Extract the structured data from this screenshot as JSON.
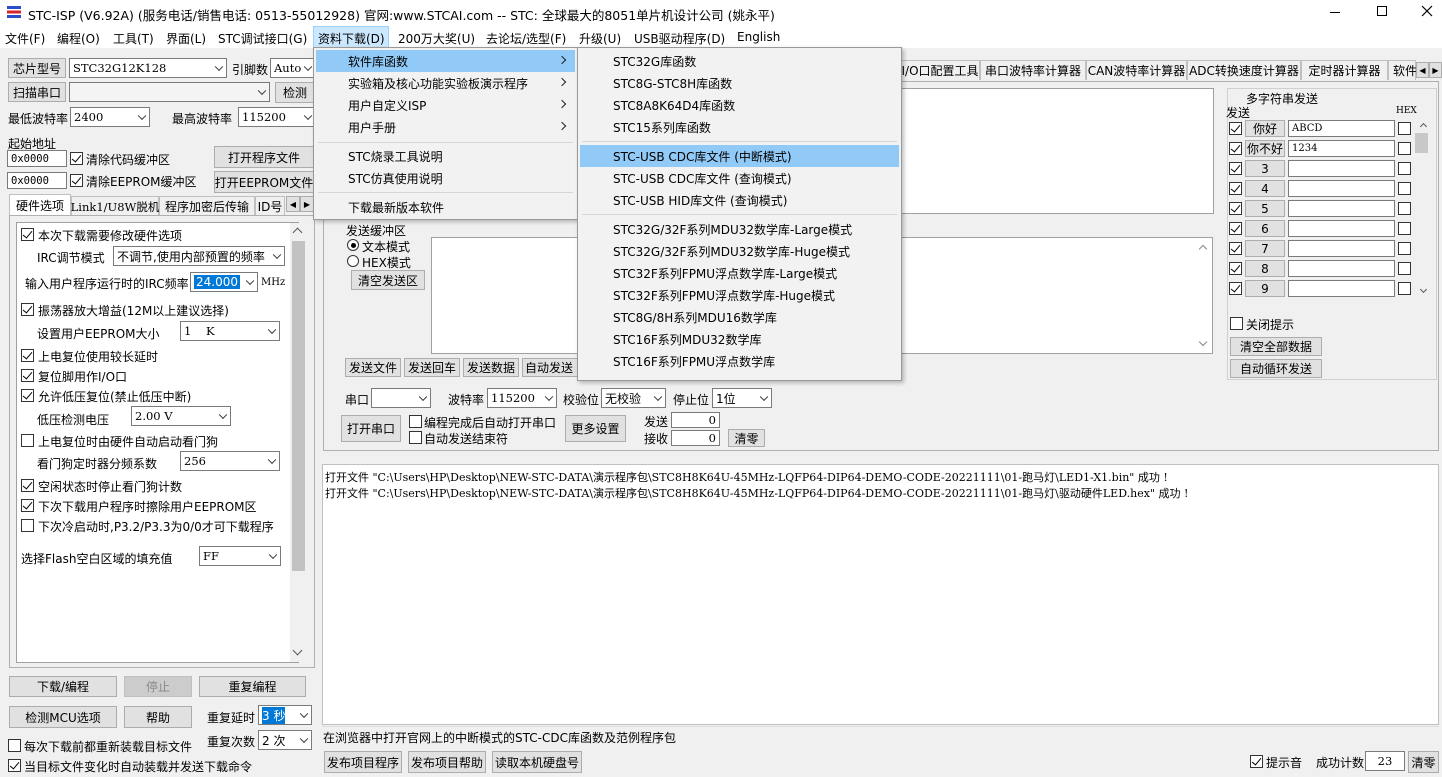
{
  "title": "STC-ISP (V6.92A) (服务电话/销售电话: 0513-55012928) 官网:www.STCAI.com  -- STC: 全球最大的8051单片机设计公司 (姚永平)",
  "menubar": [
    "文件(F)",
    "编程(O)",
    "工具(T)",
    "界面(L)",
    "STC调试接口(G)",
    "资料下载(D)",
    "200万大奖(U)",
    "去论坛/选型(F)",
    "升级(U)",
    "USB驱动程序(D)",
    "English"
  ],
  "menu_ziliao": [
    "软件库函数",
    "实验箱及核心功能实验板演示程序",
    "用户自定义ISP",
    "用户手册",
    "STC烧录工具说明",
    "STC仿真使用说明",
    "下载最新版本软件"
  ],
  "submenu": [
    "STC32G库函数",
    "STC8G-STC8H库函数",
    "STC8A8K64D4库函数",
    "STC15系列库函数",
    "STC-USB CDC库文件 (中断模式)",
    "STC-USB CDC库文件 (查询模式)",
    "STC-USB HID库文件 (查询模式)",
    "STC32G/32F系列MDU32数学库-Large模式",
    "STC32G/32F系列MDU32数学库-Huge模式",
    "STC32F系列FPMU浮点数学库-Large模式",
    "STC32F系列FPMU浮点数学库-Huge模式",
    "STC8G/8H系列MDU16数学库",
    "STC16F系列MDU32数学库",
    "STC16F系列FPMU浮点数学库"
  ],
  "left": {
    "chip_label": "芯片型号",
    "chip": "STC32G12K128",
    "pins_label": "引脚数",
    "pins": "Auto",
    "scan_port": "扫描串口",
    "check": "检测",
    "min_baud_label": "最低波特率",
    "min_baud": "2400",
    "max_baud_label": "最高波特率",
    "max_baud": "115200",
    "start_addr": "起始地址",
    "addr1": "0x0000",
    "clear_code": "清除代码缓冲区",
    "open_prog": "打开程序文件",
    "addr2": "0x0000",
    "clear_eeprom": "清除EEPROM缓冲区",
    "open_eeprom": "打开EEPROM文件",
    "tabs": [
      "硬件选项",
      "Link1/U8W脱机",
      "程序加密后传输",
      "ID号"
    ],
    "opts": {
      "o1": "本次下载需要修改硬件选项",
      "irc_mode_label": "IRC调节模式",
      "irc_mode": "不调节,使用内部预置的频率",
      "irc_freq_label": "输入用户程序运行时的IRC频率",
      "irc_freq": "24.000",
      "mhz": "MHz",
      "o2": "振荡器放大增益(12M以上建议选择)",
      "eeprom_size_label": "设置用户EEPROM大小",
      "eeprom_size": "1    K",
      "o3": "上电复位使用较长延时",
      "o4": "复位脚用作I/O口",
      "o5": "允许低压复位(禁止低压中断)",
      "lvd_label": "低压检测电压",
      "lvd": "2.00 V",
      "o6": "上电复位时由硬件自动启动看门狗",
      "wdt_label": "看门狗定时器分频系数",
      "wdt": "256",
      "o7": "空闲状态时停止看门狗计数",
      "o8": "下次下载用户程序时擦除用户EEPROM区",
      "o9": "下次冷启动时,P3.2/P3.3为0/0才可下载程序",
      "fill_label": "选择Flash空白区域的填充值",
      "fill": "FF"
    },
    "download": "下载/编程",
    "stop": "停止",
    "reprogram": "重复编程",
    "check_mcu": "检测MCU选项",
    "help": "帮助",
    "delay_label": "重复延时",
    "delay": "3 秒",
    "reload": "每次下载前都重新装载目标文件",
    "count_label": "重复次数",
    "count": "2 次",
    "auto_send": "当目标文件变化时自动装载并发送下载命令"
  },
  "right_tabs": [
    "I/O口配置工具",
    "串口波特率计算器",
    "CAN波特率计算器",
    "ADC转换速度计算器",
    "定时器计算器",
    "软件"
  ],
  "serial": {
    "send_buf": "发送缓冲区",
    "text_mode": "文本模式",
    "hex_mode": "HEX模式",
    "clear_send": "清空发送区",
    "btn_send_file": "发送文件",
    "btn_send_back": "发送回车",
    "btn_send_data": "发送数据",
    "btn_auto_send": "自动发送",
    "port_label": "串口",
    "baud_label": "波特率",
    "baud": "115200",
    "parity_label": "校验位",
    "parity": "无校验",
    "stop_label": "停止位",
    "stop": "1位",
    "open_port": "打开串口",
    "after_prog": "编程完成后自动打开串口",
    "auto_end": "自动发送结束符",
    "more": "更多设置",
    "send_label": "发送",
    "send_val": "0",
    "recv_label": "接收",
    "recv_val": "0",
    "clear": "清零"
  },
  "multi": {
    "title": "多字符串发送",
    "send": "发送",
    "hex": "HEX",
    "rows": [
      {
        "label": "你好",
        "val": "ABCD"
      },
      {
        "label": "你不好",
        "val": "1234"
      },
      {
        "label": "3",
        "val": ""
      },
      {
        "label": "4",
        "val": ""
      },
      {
        "label": "5",
        "val": ""
      },
      {
        "label": "6",
        "val": ""
      },
      {
        "label": "7",
        "val": ""
      },
      {
        "label": "8",
        "val": ""
      },
      {
        "label": "9",
        "val": ""
      }
    ],
    "close_tip": "关闭提示",
    "clear_all": "清空全部数据",
    "auto_loop": "自动循环发送"
  },
  "log": [
    "打开文件 \"C:\\Users\\HP\\Desktop\\NEW-STC-DATA\\演示程序包\\STC8H8K64U-45MHz-LQFP64-DIP64-DEMO-CODE-20221111\\01-跑马灯\\LED1-X1.bin\" 成功 !",
    "打开文件 \"C:\\Users\\HP\\Desktop\\NEW-STC-DATA\\演示程序包\\STC8H8K64U-45MHz-LQFP64-DIP64-DEMO-CODE-20221111\\01-跑马灯\\驱动硬件LED.hex\" 成功 !"
  ],
  "status": "在浏览器中打开官网上的中断模式的STC-CDC库函数及范例程序包",
  "bottom": {
    "publish": "发布项目程序",
    "publish_help": "发布项目帮助",
    "read_disk": "读取本机硬盘号",
    "sound": "提示音",
    "success_label": "成功计数",
    "success": "23",
    "clear": "清零"
  }
}
